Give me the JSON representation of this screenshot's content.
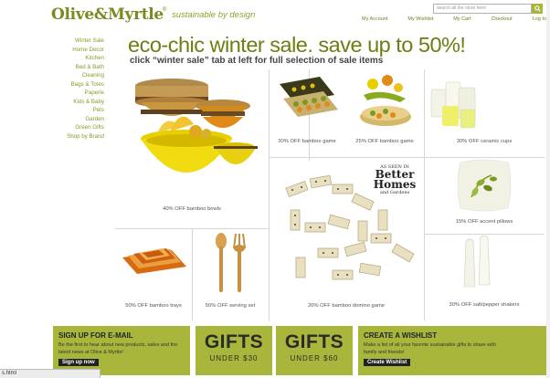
{
  "header": {
    "logo": "Olive&Myrtle",
    "logo_mark": "®",
    "tagline": "sustainable by design",
    "search_placeholder": "search all the store here",
    "links": [
      "My Account",
      "My Wishlist",
      "My Cart",
      "Checkout",
      "Log In"
    ]
  },
  "nav": {
    "items": [
      "Winter Sale",
      "Home Decor",
      "Kitchen",
      "Bed & Bath",
      "Cleaning",
      "Bags & Totes",
      "Paperie",
      "Kids & Baby",
      "Pets",
      "Garden",
      "Green Gifts",
      "Shop by Brand"
    ]
  },
  "hero": {
    "headline": "eco-chic winter sale. save up to 50%!",
    "subhead": "click “winter sale” tab at left for full selection of sale items"
  },
  "products": {
    "bowls": "40% OFF bamboo bowls",
    "game1": "30% OFF bamboo game",
    "game2": "25% OFF bamboo game",
    "cups": "30% OFF ceramic cups",
    "pillows": "15% OFF accent pillows",
    "trays": "50% OFF bamboo trays",
    "serving": "50% OFF serving set",
    "domino": "20% OFF bamboo domino game",
    "saltpepper": "30% OFF salt/pepper shakers",
    "badge_small": "AS SEEN IN",
    "badge_big": "Better Homes",
    "badge_tiny": "and Gardens"
  },
  "promo": {
    "signup_title": "SIGN UP FOR E-MAIL",
    "signup_text": "Be the first to hear about new products, sales and the latest news at Olive & Myrtle!",
    "signup_button": "Sign up now",
    "gift1_title": "GIFTS",
    "gift1_sub": "UNDER $30",
    "gift2_title": "GIFTS",
    "gift2_sub": "UNDER $60",
    "wishlist_title": "CREATE A WISHLIST",
    "wishlist_text": "Make a list of all your favorite sustainable gifts to share with family and friends!",
    "wishlist_button": "Create Wishlist"
  },
  "status": "s.html",
  "colors": {
    "brand": "#7a8a1e",
    "promo_bg": "#a8b73c"
  }
}
